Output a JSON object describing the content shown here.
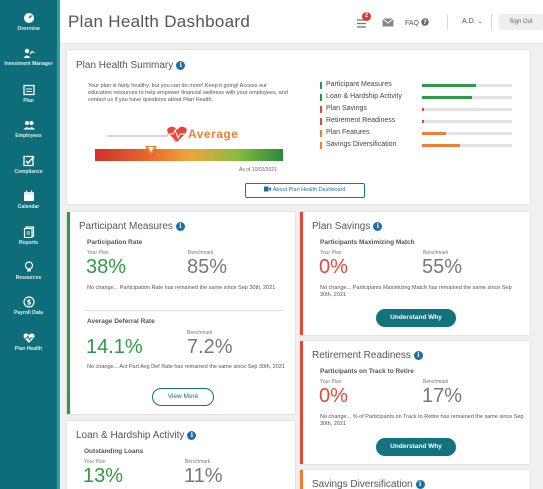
{
  "sidebar": {
    "items": [
      {
        "label": "Overview",
        "icon": "dashboard-icon"
      },
      {
        "label": "Investment Manager",
        "icon": "investment-icon"
      },
      {
        "label": "Plan",
        "icon": "plan-icon"
      },
      {
        "label": "Employees",
        "icon": "people-icon"
      },
      {
        "label": "Compliance",
        "icon": "checkbox-icon"
      },
      {
        "label": "Calendar",
        "icon": "calendar-icon"
      },
      {
        "label": "Reports",
        "icon": "reports-icon"
      },
      {
        "label": "Resources",
        "icon": "lightbulb-icon"
      },
      {
        "label": "Payroll Data",
        "icon": "dollar-icon"
      },
      {
        "label": "Plan Health",
        "icon": "heart-icon"
      }
    ]
  },
  "header": {
    "title": "Plan Health Dashboard",
    "notification_count": "2",
    "faq_label": "FAQ",
    "user_label": "A.D.",
    "signout_label": "Sign Out"
  },
  "summary": {
    "title": "Plan Health Summary",
    "text": "Your plan is fairly healthy, but you can do more! Keep it going! Access our education resources to help empower financial wellness with your employees, and contact us if you have questions about Plan Health.",
    "rating": "Average",
    "rating_level": 0.3,
    "as_of": "As of 10/02/2021",
    "about_button": "About Plan Health Dashboard",
    "metrics": [
      {
        "label": "Participant Measures",
        "fill": 0.6,
        "color": "#2e9a45"
      },
      {
        "label": "Loan & Hardship Activity",
        "fill": 0.55,
        "color": "#2e9a45"
      },
      {
        "label": "Plan Savings",
        "fill": 0.02,
        "color": "#e2483a"
      },
      {
        "label": "Retirement Readiness",
        "fill": 0.02,
        "color": "#e2483a"
      },
      {
        "label": "Plan Features",
        "fill": 0.27,
        "color": "#f07f35"
      },
      {
        "label": "Savings Diversification",
        "fill": 0.42,
        "color": "#f07f35"
      }
    ]
  },
  "participant_measures": {
    "title": "Participant Measures",
    "rate_title": "Participation Rate",
    "your_plan_label": "Your Plan",
    "benchmark_label": "Benchmark",
    "rate_value": "38%",
    "rate_benchmark": "85%",
    "rate_note": "No change... Participation Rate has remained the same since Sep 30th, 2021",
    "deferral_title": "Average Deferral Rate",
    "deferral_value": "14.1%",
    "deferral_benchmark": "7.2%",
    "deferral_note": "No change... Act Part Avg Def Rate has remained the same since Sep 30th, 2021",
    "more_button": "View More"
  },
  "plan_savings": {
    "title": "Plan Savings",
    "sub_title": "Participants Maximizing Match",
    "your_plan_label": "Your Plan",
    "benchmark_label": "Benchmark",
    "value": "0%",
    "benchmark": "55%",
    "note": "No change... Participants Maximizing Match has remained the same since Sep 30th, 2021",
    "button": "Understand Why"
  },
  "retirement_readiness": {
    "title": "Retirement Readiness",
    "sub_title": "Participants on Track to Retire",
    "your_plan_label": "Your Plan",
    "benchmark_label": "Benchmark",
    "value": "0%",
    "benchmark": "17%",
    "note": "No change... % of Participants on Track to Retire has remained the same since Sep 30th, 2021",
    "button": "Understand Why"
  },
  "loan_hardship": {
    "title": "Loan & Hardship Activity",
    "sub_title": "Outstanding Loans",
    "your_plan_label": "Your Plan",
    "benchmark_label": "Benchmark",
    "value": "13%",
    "benchmark": "11%"
  },
  "savings_diversification": {
    "title": "Savings Diversification"
  },
  "colors": {
    "teal": "#0d6d78",
    "green": "#2e9a45",
    "red": "#e2483a",
    "orange": "#f07f35",
    "blue": "#1d6fa8"
  }
}
